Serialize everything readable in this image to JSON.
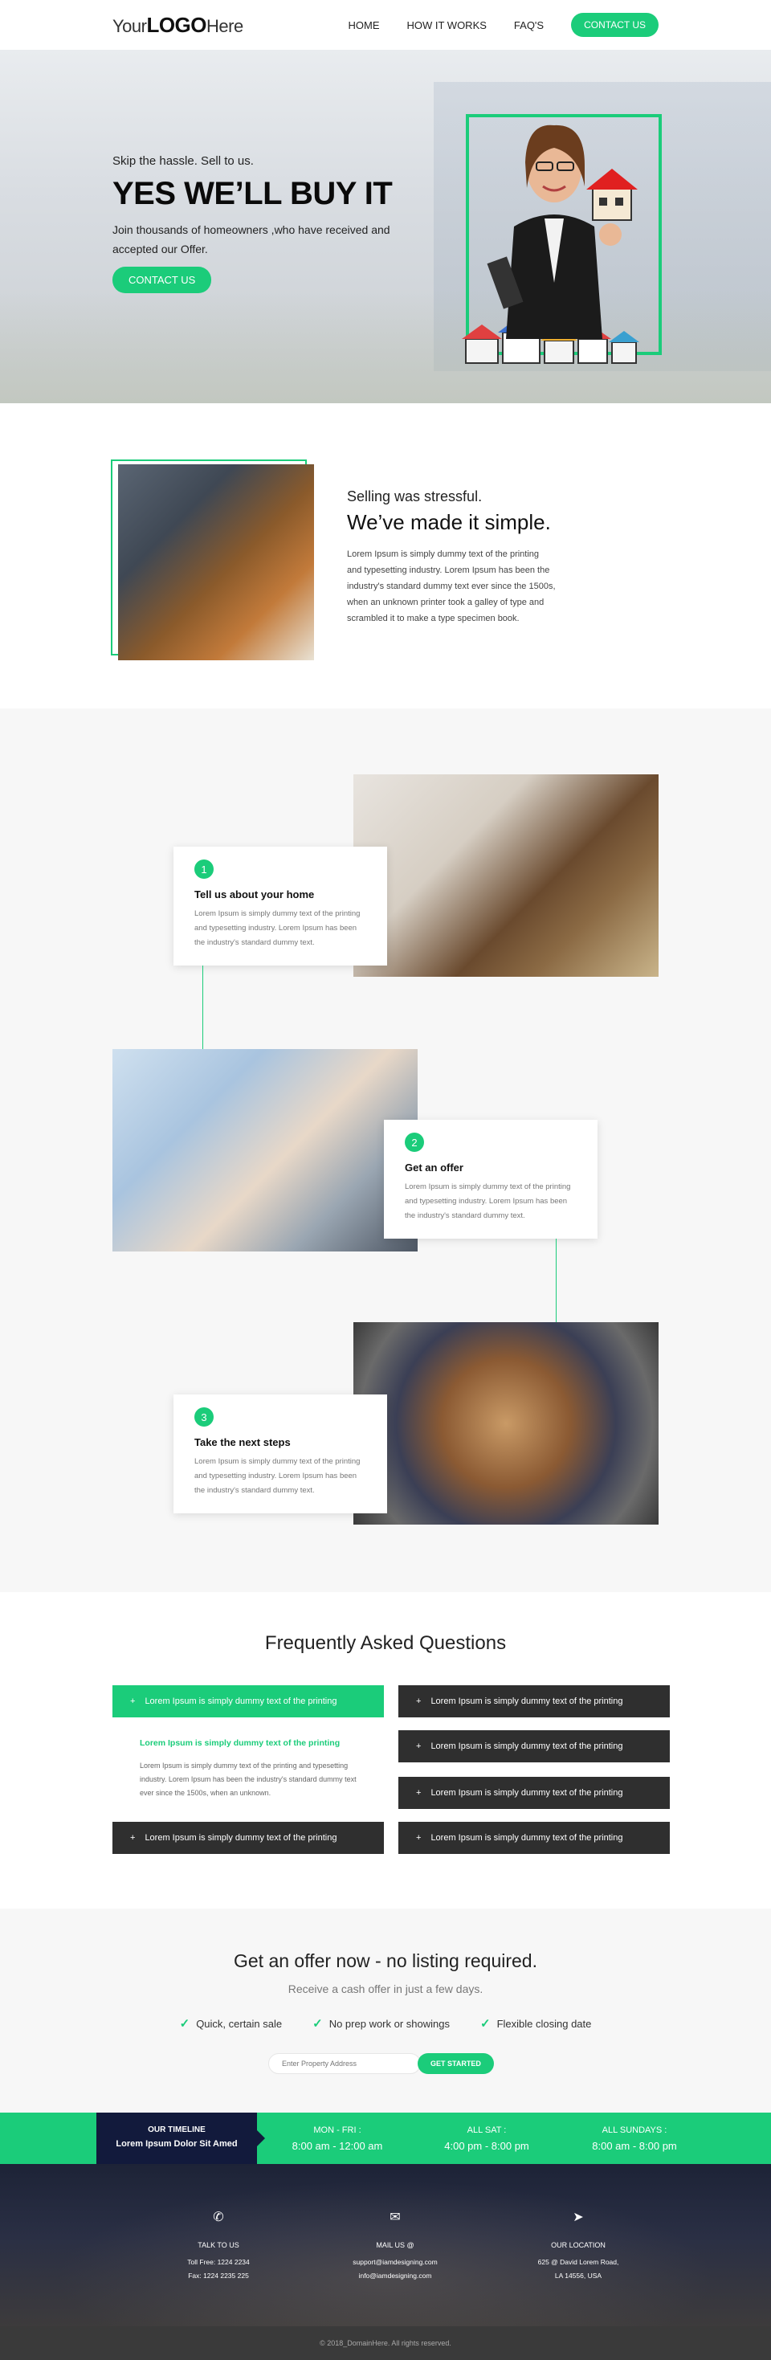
{
  "header": {
    "logo_pre": "Your",
    "logo_bold": "LOGO",
    "logo_post": "Here",
    "nav": [
      "HOME",
      "HOW IT WORKS",
      "FAQ'S"
    ],
    "cta": "CONTACT US"
  },
  "hero": {
    "subtitle": "Skip the hassle. Sell to us.",
    "title": "YES WE’LL BUY IT",
    "text": "Join thousands of homeowners ,who have received and accepted our Offer.",
    "cta": "CONTACT US"
  },
  "intro": {
    "subtitle": "Selling was stressful.",
    "title": "We’ve made it simple.",
    "body": "Lorem Ipsum is simply dummy text of the printing and typesetting industry. Lorem Ipsum has been the industry's standard dummy text ever since the 1500s, when an unknown printer took a galley of type and scrambled it to make a type specimen book."
  },
  "steps": [
    {
      "num": "1",
      "title": "Tell us about your home",
      "body": "Lorem Ipsum is simply dummy text of the printing and typesetting industry. Lorem Ipsum has been the industry's standard dummy text."
    },
    {
      "num": "2",
      "title": "Get an offer",
      "body": "Lorem Ipsum is simply dummy text of the printing and typesetting industry. Lorem Ipsum has been the industry's standard dummy text."
    },
    {
      "num": "3",
      "title": "Take the next steps",
      "body": "Lorem Ipsum is simply dummy text of the printing and typesetting industry. Lorem Ipsum has been the industry's standard dummy text."
    }
  ],
  "faq": {
    "title": "Frequently Asked Questions",
    "items": [
      "Lorem Ipsum is simply dummy text of the printing",
      "Lorem Ipsum is simply dummy text of the printing",
      "Lorem Ipsum is simply dummy text of the printing",
      "Lorem Ipsum is simply dummy text of the printing",
      "Lorem Ipsum is simply dummy text of the printing",
      "Lorem Ipsum is simply dummy text of the printing"
    ],
    "open_title": "Lorem Ipsum is simply dummy text of the printing",
    "open_body": "Lorem Ipsum is simply dummy text of the printing and typesetting industry. Lorem Ipsum has been the industry's standard dummy text ever since the 1500s, when an unknown."
  },
  "offer": {
    "title": "Get an offer now - no listing required.",
    "subtitle": "Receive a cash offer in just a few days.",
    "features": [
      "Quick, certain sale",
      "No prep work or showings",
      "Flexible closing date"
    ],
    "placeholder": "Enter Property Address",
    "button": "GET STARTED"
  },
  "hours": {
    "timeline_label": "OUR TIMELINE",
    "timeline_sub": "Lorem Ipsum Dolor Sit Amed",
    "cols": [
      {
        "day": "MON - FRI :",
        "time": "8:00 am - 12:00 am"
      },
      {
        "day": "ALL SAT :",
        "time": "4:00 pm - 8:00 pm"
      },
      {
        "day": "ALL SUNDAYS :",
        "time": "8:00 am - 8:00 pm"
      }
    ]
  },
  "contact": {
    "cols": [
      {
        "icon": "phone-icon",
        "label": "TALK TO US",
        "lines": [
          "Toll Free: 1224 2234",
          "Fax: 1224 2235 225"
        ]
      },
      {
        "icon": "mail-icon",
        "label": "MAIL US @",
        "lines": [
          "support@iamdesigning.com",
          "info@iamdesigning.com"
        ]
      },
      {
        "icon": "send-icon",
        "label": "OUR LOCATION",
        "lines": [
          "625 @ David Lorem Road,",
          "LA 14556, USA"
        ]
      }
    ]
  },
  "copyright": "© 2018_DomainHere. All rights reserved.",
  "colors": {
    "accent": "#1bcc7a",
    "dark": "#2f2f2f",
    "navy": "#121a3c"
  }
}
